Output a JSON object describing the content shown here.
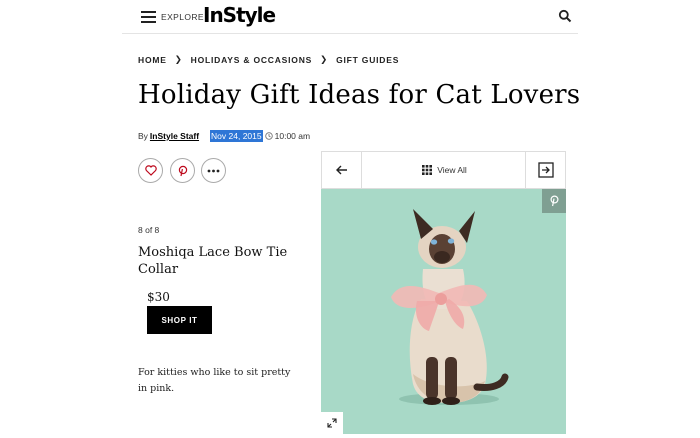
{
  "header": {
    "explore_label": "EXPLORE",
    "logo_text": "InStyle"
  },
  "breadcrumb": [
    "HOME",
    "HOLIDAYS & OCCASIONS",
    "GIFT GUIDES"
  ],
  "article": {
    "title": "Holiday Gift Ideas for Cat Lovers",
    "byline_prefix": "By",
    "author": "InStyle Staff",
    "date": "Nov 24, 2015",
    "time": "10:00 am"
  },
  "share_icons": [
    "heart-icon",
    "pinterest-icon",
    "more-icon"
  ],
  "slide": {
    "counter": "8 of 8",
    "product_title": "Moshiqa Lace Bow Tie Collar",
    "price": "$30",
    "shop_label": "SHOP IT",
    "description": "For kitties who like to sit pretty in pink."
  },
  "gallery": {
    "view_all_label": "View All"
  },
  "colors": {
    "accent_pinterest": "#bd081c",
    "photo_background": "#a8d9c7",
    "date_highlight": "#2e76d6"
  }
}
